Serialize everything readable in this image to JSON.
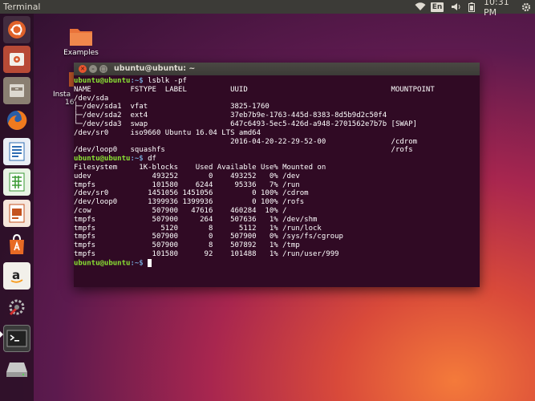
{
  "panel": {
    "app_title": "Terminal",
    "lang": "En",
    "clock": "10:31 PM",
    "icons": [
      "wifi-icon",
      "volume-icon",
      "battery-icon",
      "gear-icon"
    ]
  },
  "launcher": {
    "items": [
      {
        "name": "ubuntu-dash",
        "icon": "ubuntu-logo-icon"
      },
      {
        "name": "system-settings",
        "icon": "settings-icon"
      },
      {
        "name": "files",
        "icon": "folder-drawer-icon"
      },
      {
        "name": "firefox",
        "icon": "firefox-icon"
      },
      {
        "name": "libreoffice-writer",
        "icon": "writer-icon"
      },
      {
        "name": "libreoffice-calc",
        "icon": "calc-icon"
      },
      {
        "name": "libreoffice-impress",
        "icon": "impress-icon"
      },
      {
        "name": "ubuntu-software",
        "icon": "software-bag-icon"
      },
      {
        "name": "amazon",
        "icon": "amazon-icon"
      },
      {
        "name": "system-tools",
        "icon": "wrench-icon"
      },
      {
        "name": "terminal",
        "icon": "terminal-icon"
      },
      {
        "name": "drive",
        "icon": "drive-icon"
      }
    ]
  },
  "desktop": {
    "examples_label": "Examples",
    "install_label_line1": "Insta",
    "install_label_line2": "16."
  },
  "terminal": {
    "window_title": "ubuntu@ubuntu: ~",
    "prompt_user": "ubuntu@ubuntu",
    "prompt_path": ":~$",
    "cmd1": " lsblk -pf",
    "lsblk_lines": [
      "NAME         FSTYPE  LABEL          UUID                                 MOUNTPOINT",
      "/dev/sda",
      "├─/dev/sda1  vfat                   3825-1760",
      "├─/dev/sda2  ext4                   37eb7b9e-1763-445d-8383-8d5b9d2c50f4",
      "└─/dev/sda3  swap                   647c6493-5ec5-426d-a948-2701562e7b7b [SWAP]",
      "/dev/sr0     iso9660 Ubuntu 16.04 LTS amd64",
      "                                    2016-04-20-22-29-52-00               /cdrom",
      "/dev/loop0   squashfs                                                    /rofs"
    ],
    "cmd2": " df",
    "df_lines": [
      "Filesystem     1K-blocks    Used Available Use% Mounted on",
      "udev              493252       0    493252   0% /dev",
      "tmpfs             101580    6244     95336   7% /run",
      "/dev/sr0         1451056 1451056         0 100% /cdrom",
      "/dev/loop0       1399936 1399936         0 100% /rofs",
      "/cow              507900   47616    460284  10% /",
      "tmpfs             507900     264    507636   1% /dev/shm",
      "tmpfs               5120       8      5112   1% /run/lock",
      "tmpfs             507900       0    507900   0% /sys/fs/cgroup",
      "tmpfs             507900       8    507892   1% /tmp",
      "tmpfs             101580      92    101488   1% /run/user/999"
    ]
  }
}
